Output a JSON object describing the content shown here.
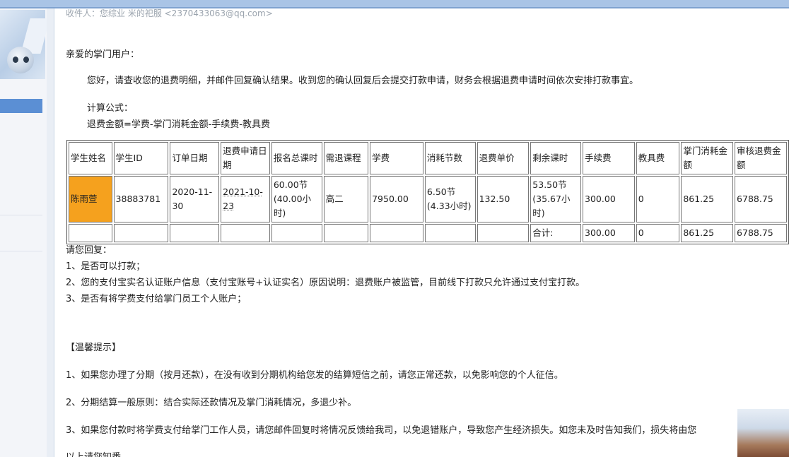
{
  "email": {
    "recipient_partial": "收件人：您综业 米的祀服 <2370433063@qq.com>",
    "greeting": "亲爱的掌门用户：",
    "intro": "您好，请查收您的退费明细，并邮件回复确认结果。收到您的确认回复后会提交打款申请，财务会根据退费申请时间依次安排打款事宜。",
    "formula_label": "计算公式：",
    "formula": "退费金额=学费-掌门消耗金额-手续费-教具费"
  },
  "table": {
    "headers": [
      "学生姓名",
      "学生ID",
      "订单日期",
      "退费申请日期",
      "报名总课时",
      "需退课程",
      "学费",
      "消耗节数",
      "退费单价",
      "剩余课时",
      "手续费",
      "教具费",
      "掌门消耗金额",
      "审核退费金额"
    ],
    "row": [
      "陈雨萱",
      "38883781",
      "2020-11-30",
      "2021-10-23",
      "60.00节(40.00小时)",
      "高二",
      "7950.00",
      "6.50节(4.33小时)",
      "132.50",
      "53.50节(35.67小时)",
      "300.00",
      "0",
      "861.25",
      "6788.75"
    ],
    "total_label": "合计:",
    "totals": [
      "300.00",
      "0",
      "861.25",
      "6788.75"
    ]
  },
  "reply": {
    "title": "请您回复：",
    "items": [
      "1、是否可以打款；",
      "2、您的支付宝实名认证账户信息（支付宝账号+认证实名）原因说明：退费账户被监管，目前线下打款只允许通过支付宝打款。",
      "3、是否有将学费支付给掌门员工个人账户；"
    ]
  },
  "tips": {
    "title": "【温馨提示】",
    "items": [
      "1、如果您办理了分期（按月还款），在没有收到分期机构给您发的结算短信之前，请您正常还款，以免影响您的个人征信。",
      "2、分期结算一般原则：结合实际还款情况及掌门消耗情况，多退少补。",
      "3、如果您付款时将学费支付给掌门工作人员，请您邮件回复时将情况反馈给我司，以免退错账户，导致您产生经济损失。如您未及时告知我们，损失将由您"
    ],
    "closing": "以上请您知悉"
  }
}
